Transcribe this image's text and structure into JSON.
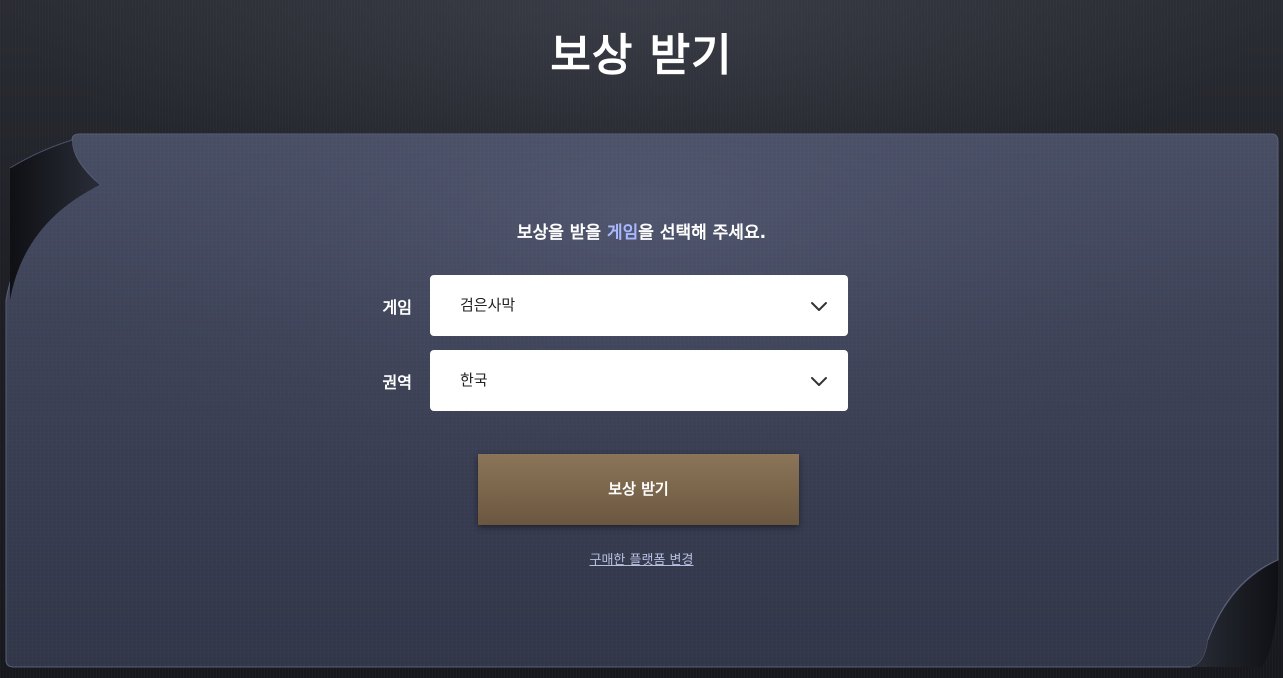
{
  "page": {
    "title": "보상 받기"
  },
  "form": {
    "prompt_before": "보상을 받을 ",
    "prompt_highlight": "게임",
    "prompt_after": "을 선택해 주세요.",
    "game": {
      "label": "게임",
      "selected": "검은사막",
      "icon": "chevron-down-icon"
    },
    "region": {
      "label": "권역",
      "selected": "한국",
      "icon": "chevron-down-icon"
    },
    "submit_label": "보상 받기",
    "change_platform_label": "구매한 플랫폼 변경"
  },
  "colors": {
    "background": "#1c1e24",
    "panel": "#3a3f53",
    "highlight": "#a9b8ff",
    "button": "#7a654b",
    "link": "#b7bfe0"
  }
}
